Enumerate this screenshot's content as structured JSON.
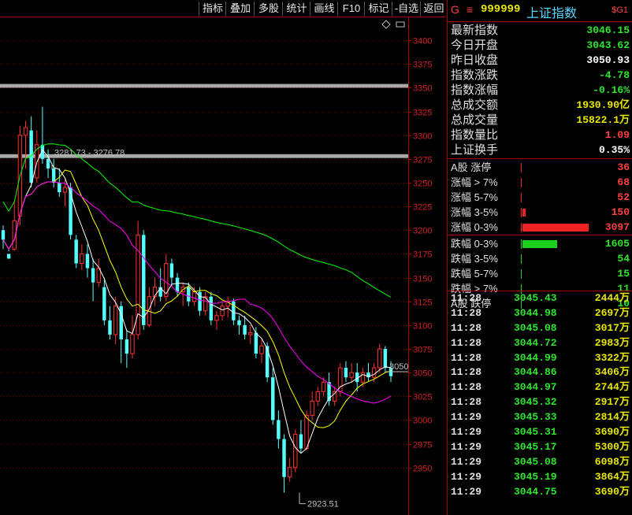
{
  "toolbar": {
    "buttons": [
      "指标",
      "叠加",
      "多股",
      "统计",
      "画线",
      "F10",
      "标记",
      "-自选",
      "返回"
    ]
  },
  "header": {
    "g_badge": "G",
    "menu_glyph": "≡",
    "code": "999999",
    "name": "上证指数",
    "tag": "$G1"
  },
  "stats": [
    {
      "label": "最新指数",
      "value": "3046.15",
      "color": "#2ee62e"
    },
    {
      "label": "今日开盘",
      "value": "3043.62",
      "color": "#2ee62e"
    },
    {
      "label": "昨日收盘",
      "value": "3050.93",
      "color": "#ffffff"
    },
    {
      "label": "指数涨跌",
      "value": "-4.78",
      "color": "#2ee62e"
    },
    {
      "label": "指数涨幅",
      "value": "-0.16%",
      "color": "#2ee62e"
    },
    {
      "label": "总成交额",
      "value": "1930.90亿",
      "color": "#e8e800"
    },
    {
      "label": "总成交量",
      "value": "15822.1万",
      "color": "#e8e800"
    },
    {
      "label": "指数量比",
      "value": "1.09",
      "color": "#ff4040"
    },
    {
      "label": "上证换手",
      "value": "0.35%",
      "color": "#ffffff"
    }
  ],
  "breadth_up": [
    {
      "label": "A股 涨停",
      "value": "36",
      "bar": 0
    },
    {
      "label": "涨幅 > 7%",
      "value": "68",
      "bar": 0
    },
    {
      "label": "涨幅 5-7%",
      "value": "52",
      "bar": 0
    },
    {
      "label": "涨幅 3-5%",
      "value": "150",
      "bar": 0.05
    },
    {
      "label": "涨幅 0-3%",
      "value": "3097",
      "bar": 1.0
    }
  ],
  "breadth_down": [
    {
      "label": "跌幅 0-3%",
      "value": "1605",
      "bar": 0.52
    },
    {
      "label": "跌幅 3-5%",
      "value": "54",
      "bar": 0
    },
    {
      "label": "跌幅 5-7%",
      "value": "15",
      "bar": 0
    },
    {
      "label": "跌幅 > 7%",
      "value": "11",
      "bar": 0
    },
    {
      "label": "A股 跌停",
      "value": "10",
      "bar": 0
    }
  ],
  "ticks": [
    {
      "time": "11:28",
      "price": "3045.43",
      "volume": "2444万"
    },
    {
      "time": "11:28",
      "price": "3044.98",
      "volume": "2697万"
    },
    {
      "time": "11:28",
      "price": "3045.08",
      "volume": "3017万"
    },
    {
      "time": "11:28",
      "price": "3044.72",
      "volume": "2983万"
    },
    {
      "time": "11:28",
      "price": "3044.99",
      "volume": "3322万"
    },
    {
      "time": "11:28",
      "price": "3044.86",
      "volume": "3406万"
    },
    {
      "time": "11:28",
      "price": "3044.97",
      "volume": "2744万"
    },
    {
      "time": "11:28",
      "price": "3045.32",
      "volume": "2917万"
    },
    {
      "time": "11:29",
      "price": "3045.33",
      "volume": "2814万"
    },
    {
      "time": "11:29",
      "price": "3045.31",
      "volume": "3690万"
    },
    {
      "time": "11:29",
      "price": "3045.17",
      "volume": "5300万"
    },
    {
      "time": "11:29",
      "price": "3045.08",
      "volume": "6098万"
    },
    {
      "time": "11:29",
      "price": "3045.19",
      "volume": "3864万"
    },
    {
      "time": "11:29",
      "price": "3044.75",
      "volume": "3690万"
    }
  ],
  "chart_data": {
    "type": "candlestick",
    "y_axis": {
      "min": 2900,
      "max": 3425,
      "ticks": [
        2950,
        2975,
        3000,
        3025,
        3050,
        3075,
        3100,
        3125,
        3150,
        3175,
        3200,
        3225,
        3250,
        3275,
        3300,
        3325,
        3350,
        3375,
        3400
      ]
    },
    "current_price_label": "3050",
    "current_price": 3050.93,
    "annotations": {
      "high_label": "3281.73 - 3276.78",
      "high_value": 3281.73,
      "low_label": "2923.51",
      "low_value": 2923.51
    },
    "zones": [
      {
        "from": 3350,
        "to": 3354
      },
      {
        "from": 3276,
        "to": 3280
      }
    ],
    "colors": {
      "up": "#ff3030",
      "down": "#54ffff",
      "ma_short": "#ffffff",
      "ma_mid": "#ffff00",
      "ma_long": "#ff00ff",
      "ma_xlong": "#00ff00"
    },
    "candles": [
      [
        3200,
        3205,
        3190,
        3180
      ],
      [
        3175,
        3178,
        3170,
        3180
      ],
      [
        3180,
        3230,
        3210,
        3178
      ],
      [
        3215,
        3310,
        3300,
        3205
      ],
      [
        3300,
        3315,
        3308,
        3265
      ],
      [
        3305,
        3320,
        3250,
        3245
      ],
      [
        3255,
        3305,
        3290,
        3250
      ],
      [
        3290,
        3330,
        3275,
        3270
      ],
      [
        3275,
        3285,
        3265,
        3255
      ],
      [
        3265,
        3275,
        3250,
        3245
      ],
      [
        3250,
        3265,
        3240,
        3235
      ],
      [
        3240,
        3255,
        3245,
        3225
      ],
      [
        3245,
        3250,
        3195,
        3190
      ],
      [
        3190,
        3195,
        3165,
        3160
      ],
      [
        3165,
        3185,
        3175,
        3158
      ],
      [
        3175,
        3185,
        3160,
        3150
      ],
      [
        3160,
        3170,
        3145,
        3125
      ],
      [
        3145,
        3170,
        3160,
        3140
      ],
      [
        3140,
        3150,
        3105,
        3100
      ],
      [
        3105,
        3120,
        3090,
        3085
      ],
      [
        3090,
        3130,
        3120,
        3080
      ],
      [
        3120,
        3125,
        3085,
        3060
      ],
      [
        3085,
        3095,
        3070,
        3055
      ],
      [
        3070,
        3110,
        3090,
        3065
      ],
      [
        3090,
        3210,
        3195,
        3085
      ],
      [
        3195,
        3200,
        3100,
        3095
      ],
      [
        3100,
        3140,
        3130,
        3098
      ],
      [
        3130,
        3150,
        3140,
        3120
      ],
      [
        3140,
        3160,
        3130,
        3125
      ],
      [
        3130,
        3175,
        3165,
        3125
      ],
      [
        3165,
        3170,
        3150,
        3140
      ],
      [
        3150,
        3155,
        3135,
        3130
      ],
      [
        3135,
        3145,
        3140,
        3120
      ],
      [
        3140,
        3145,
        3125,
        3120
      ],
      [
        3125,
        3140,
        3135,
        3120
      ],
      [
        3135,
        3140,
        3115,
        3110
      ],
      [
        3115,
        3135,
        3130,
        3110
      ],
      [
        3130,
        3135,
        3105,
        3100
      ],
      [
        3105,
        3115,
        3110,
        3095
      ],
      [
        3110,
        3125,
        3120,
        3105
      ],
      [
        3120,
        3130,
        3125,
        3108
      ],
      [
        3125,
        3128,
        3105,
        3100
      ],
      [
        3105,
        3110,
        3100,
        3090
      ],
      [
        3100,
        3110,
        3090,
        3085
      ],
      [
        3090,
        3100,
        3092,
        3080
      ],
      [
        3092,
        3098,
        3070,
        3065
      ],
      [
        3070,
        3085,
        3078,
        3060
      ],
      [
        3078,
        3082,
        3045,
        3040
      ],
      [
        3045,
        3055,
        3000,
        2995
      ],
      [
        3000,
        3010,
        2980,
        2970
      ],
      [
        2980,
        2985,
        2940,
        2923.51
      ],
      [
        2940,
        2960,
        2950,
        2935
      ],
      [
        2950,
        2990,
        2985,
        2945
      ],
      [
        2985,
        3000,
        2970,
        2965
      ],
      [
        2970,
        3010,
        3005,
        2968
      ],
      [
        3005,
        3030,
        3020,
        3000
      ],
      [
        3020,
        3035,
        3030,
        3015
      ],
      [
        3030,
        3045,
        3040,
        3025
      ],
      [
        3040,
        3050,
        3020,
        3015
      ],
      [
        3020,
        3035,
        3030,
        3015
      ],
      [
        3030,
        3060,
        3055,
        3025
      ],
      [
        3055,
        3062,
        3045,
        3040
      ],
      [
        3045,
        3060,
        3050,
        3040
      ],
      [
        3050,
        3060,
        3040,
        3030
      ],
      [
        3040,
        3055,
        3050,
        3035
      ],
      [
        3050,
        3060,
        3045,
        3040
      ],
      [
        3045,
        3060,
        3055,
        3040
      ],
      [
        3055,
        3080,
        3075,
        3050
      ],
      [
        3075,
        3078,
        3055,
        3050
      ],
      [
        3055,
        3062,
        3046.15,
        3040
      ]
    ]
  }
}
